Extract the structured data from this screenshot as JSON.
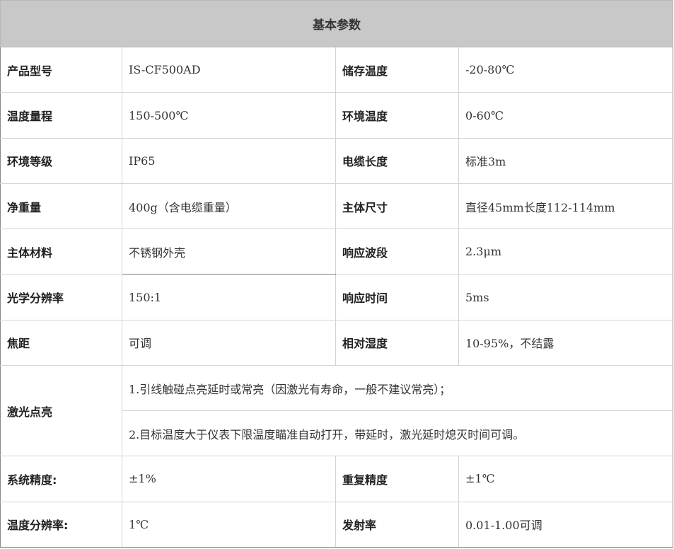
{
  "header": {
    "title": "基本参数"
  },
  "rows": [
    {
      "l1": "产品型号",
      "v1": "IS-CF500AD",
      "l2": "储存温度",
      "v2": "-20-80℃"
    },
    {
      "l1": "温度量程",
      "v1": "150-500℃",
      "l2": "环境温度",
      "v2": "0-60℃"
    },
    {
      "l1": "环境等级",
      "v1": "IP65",
      "l2": "电缆长度",
      "v2": "标准3m"
    },
    {
      "l1": "净重量",
      "v1": "400g（含电缆重量）",
      "l2": "主体尺寸",
      "v2": "直径45mm长度112-114mm"
    },
    {
      "l1": "主体材料",
      "v1": "不锈钢外壳",
      "l2": "响应波段",
      "v2": "2.3μm"
    },
    {
      "l1": "光学分辨率",
      "v1": "150:1",
      "l2": "响应时间",
      "v2": "5ms"
    },
    {
      "l1": "焦距",
      "v1": "可调",
      "l2": "相对湿度",
      "v2": "10-95%，不结露"
    }
  ],
  "laser": {
    "label": "激光点亮",
    "line1": "1.引线触碰点亮延时或常亮（因激光有寿命，一般不建议常亮）；",
    "line2": "2.目标温度大于仪表下限温度瞄准自动打开，带延时，激光延时熄灭时间可调。"
  },
  "rows_bottom": [
    {
      "l1": "系统精度:",
      "v1": "±1%",
      "l2": "重复精度",
      "v2": "±1℃"
    },
    {
      "l1": "温度分辨率:",
      "v1": "1℃",
      "l2": "发射率",
      "v2": "0.01-1.00可调"
    }
  ]
}
